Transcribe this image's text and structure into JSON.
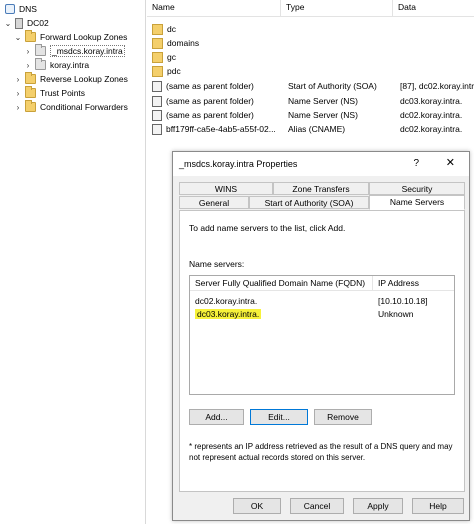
{
  "tree": {
    "root": "DNS",
    "server": "DC02",
    "forward_zones": "Forward Lookup Zones",
    "msdcs": "_msdcs.koray.intra",
    "koray": "koray.intra",
    "reverse_zones": "Reverse Lookup Zones",
    "trust_points": "Trust Points",
    "conditional": "Conditional Forwarders",
    "expand_open": "⌄",
    "expand_closed": "›"
  },
  "list": {
    "columns": [
      "Name",
      "Type",
      "Data"
    ],
    "rows": [
      {
        "name": "dc",
        "type": "",
        "data": "",
        "icon": "folder-icon"
      },
      {
        "name": "domains",
        "type": "",
        "data": "",
        "icon": "folder-icon"
      },
      {
        "name": "gc",
        "type": "",
        "data": "",
        "icon": "folder-icon"
      },
      {
        "name": "pdc",
        "type": "",
        "data": "",
        "icon": "folder-icon"
      },
      {
        "name": "(same as parent folder)",
        "type": "Start of Authority (SOA)",
        "data": "[87], dc02.koray.intr",
        "icon": "record-icon"
      },
      {
        "name": "(same as parent folder)",
        "type": "Name Server (NS)",
        "data": "dc03.koray.intra.",
        "icon": "record-icon"
      },
      {
        "name": "(same as parent folder)",
        "type": "Name Server (NS)",
        "data": "dc02.koray.intra.",
        "icon": "record-icon"
      },
      {
        "name": "bff179ff-ca5e-4ab5-a55f-02...",
        "type": "Alias (CNAME)",
        "data": "dc02.koray.intra.",
        "icon": "record-icon"
      }
    ]
  },
  "dialog": {
    "title": "_msdcs.koray.intra Properties",
    "help": "?",
    "close": "✕",
    "tabs_row1": [
      "WINS",
      "Zone Transfers",
      "Security"
    ],
    "tabs_row2": [
      "General",
      "Start of Authority (SOA)",
      "Name Servers"
    ],
    "intro": "To add name servers to the list, click Add.",
    "ns_label": "Name servers:",
    "ns_columns": [
      "Server Fully Qualified Domain Name (FQDN)",
      "IP Address"
    ],
    "ns_rows": [
      {
        "fqdn": "dc02.koray.intra.",
        "ip": "[10.10.10.18]"
      },
      {
        "fqdn": "dc03.koray.intra.",
        "ip": "Unknown"
      }
    ],
    "add": "Add...",
    "edit": "Edit...",
    "remove": "Remove",
    "footnote": "* represents an IP address retrieved as the result of a DNS query and may not represent actual records stored on this server.",
    "ok": "OK",
    "cancel": "Cancel",
    "apply": "Apply",
    "help_btn": "Help"
  },
  "colors": {
    "highlight": "#f7f23a",
    "accent": "#0078d7"
  }
}
